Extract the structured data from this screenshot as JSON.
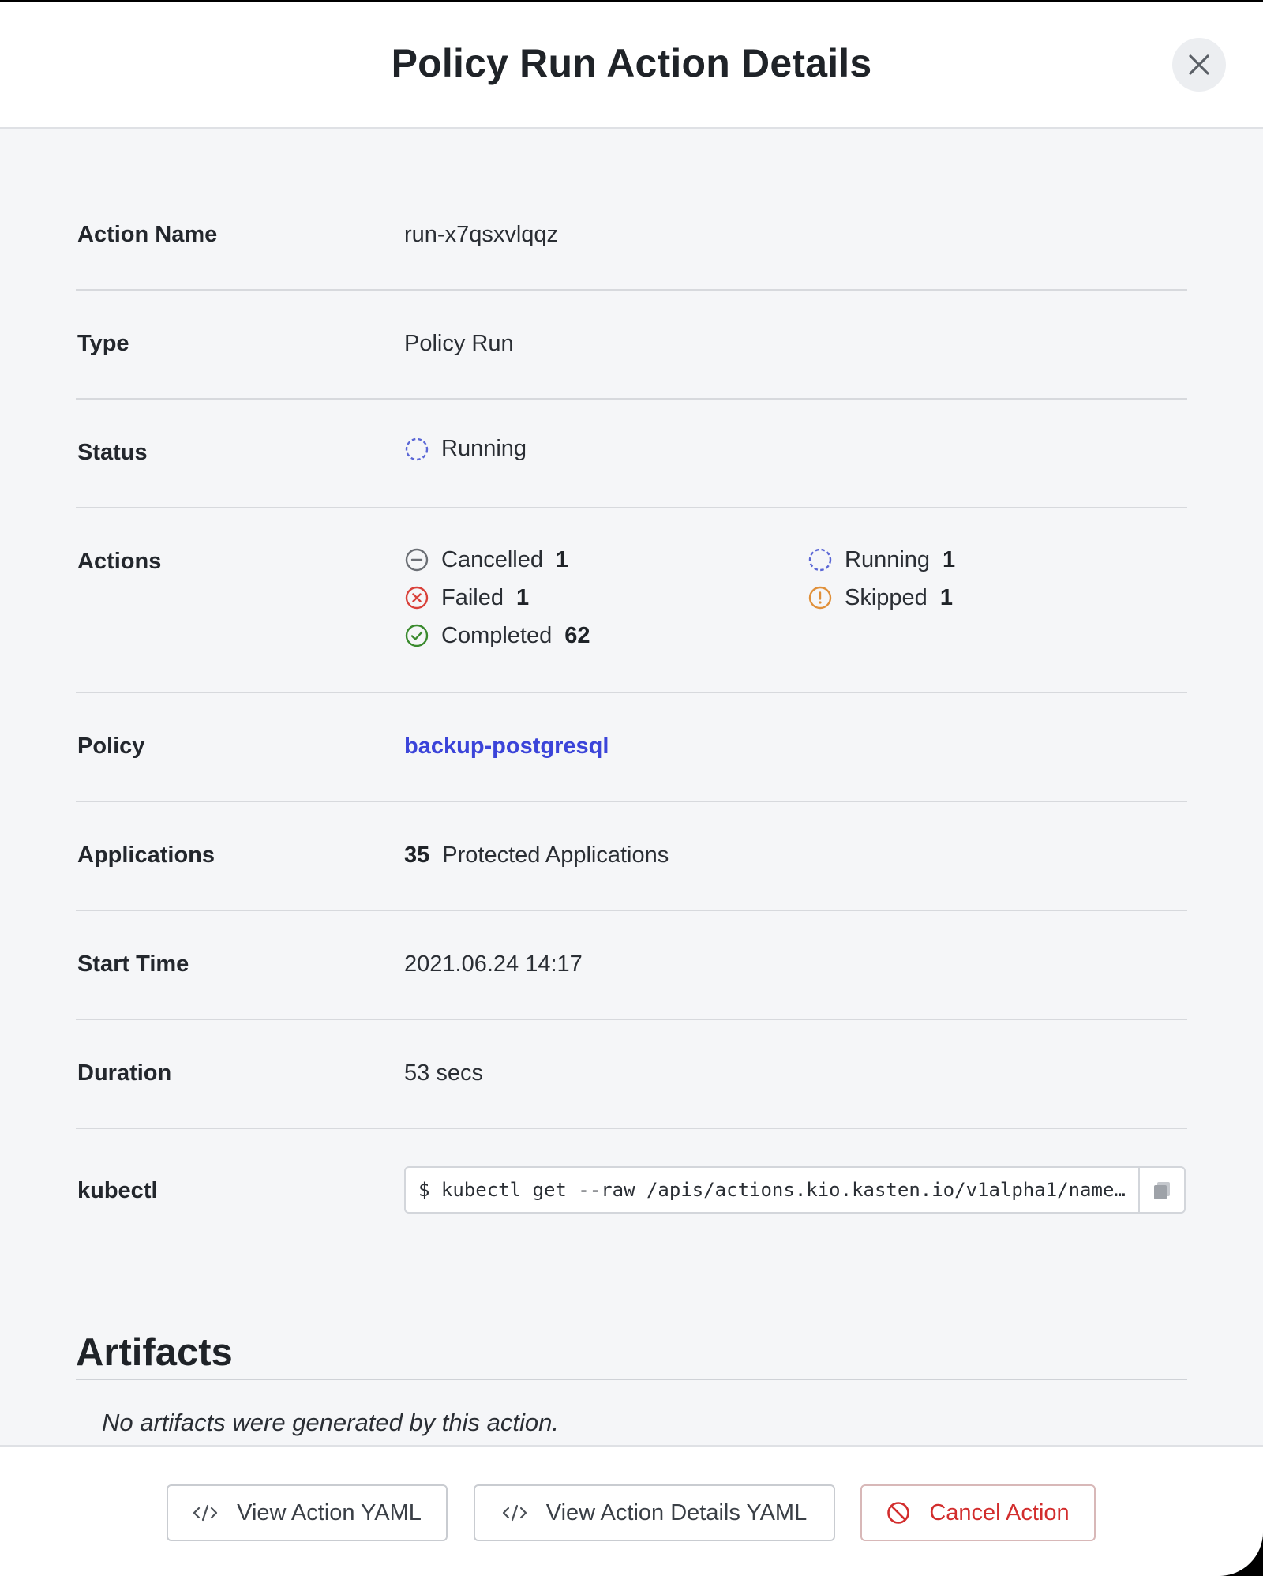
{
  "modal": {
    "title": "Policy Run Action Details"
  },
  "details": {
    "action_name": {
      "label": "Action Name",
      "value": "run-x7qsxvlqqz"
    },
    "type": {
      "label": "Type",
      "value": "Policy Run"
    },
    "status": {
      "label": "Status",
      "value": "Running",
      "icon": "running-icon"
    },
    "actions": {
      "label": "Actions",
      "items": [
        {
          "label": "Cancelled",
          "count": "1",
          "icon": "cancelled-icon",
          "color": "#6b6f75"
        },
        {
          "label": "Failed",
          "count": "1",
          "icon": "failed-icon",
          "color": "#d9413a"
        },
        {
          "label": "Completed",
          "count": "62",
          "icon": "completed-icon",
          "color": "#3a8a2e"
        },
        {
          "label": "Running",
          "count": "1",
          "icon": "running-icon",
          "color": "#5b67d6"
        },
        {
          "label": "Skipped",
          "count": "1",
          "icon": "skipped-icon",
          "color": "#e0903a"
        }
      ]
    },
    "policy": {
      "label": "Policy",
      "value": "backup-postgresql"
    },
    "applications": {
      "label": "Applications",
      "count": "35",
      "text": "Protected Applications"
    },
    "start_time": {
      "label": "Start Time",
      "value": "2021.06.24 14:17"
    },
    "duration": {
      "label": "Duration",
      "value": "53 secs"
    },
    "kubectl": {
      "label": "kubectl",
      "value": "$ kubectl get --raw /apis/actions.kio.kasten.io/v1alpha1/name…"
    }
  },
  "artifacts": {
    "title": "Artifacts",
    "empty_message": "No artifacts were generated by this action."
  },
  "footer": {
    "view_action_yaml": "View Action YAML",
    "view_action_details_yaml": "View Action Details YAML",
    "cancel_action": "Cancel Action"
  },
  "colors": {
    "link": "#3b44d9",
    "danger": "#d22d2d",
    "running": "#5b67d6"
  }
}
